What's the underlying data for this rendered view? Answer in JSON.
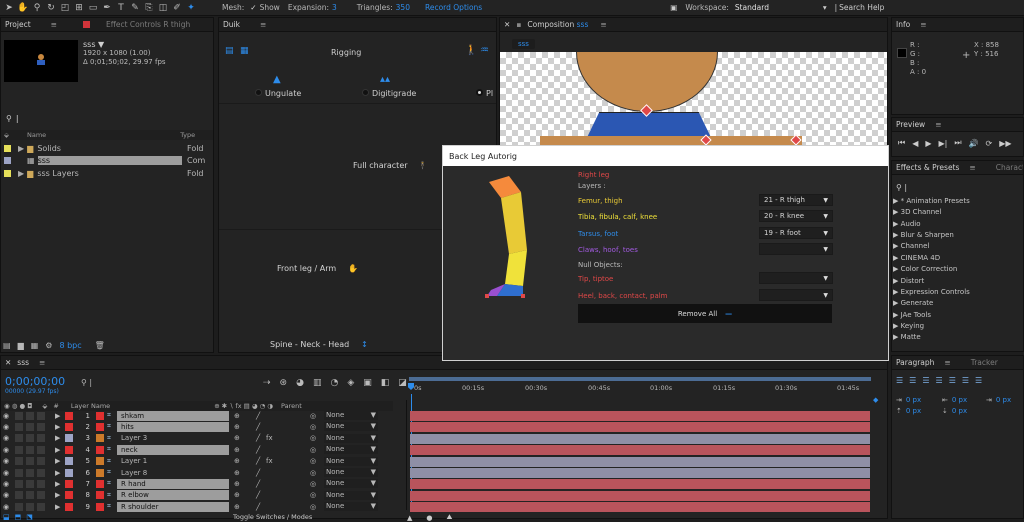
{
  "top": {
    "mesh_label": "Mesh:",
    "show_label": "Show",
    "expansion_label": "Expansion:",
    "expansion_value": "3",
    "triangles_label": "Triangles:",
    "triangles_value": "350",
    "record_options": "Record Options",
    "workspace_label": "Workspace:",
    "workspace_value": "Standard",
    "search_help": "Search Help"
  },
  "project": {
    "tab": "Project",
    "effect_controls_tab": "Effect Controls R thigh",
    "comp_name": "sss ▼",
    "comp_res": "1920 x 1080 (1.00)",
    "comp_dur": "Δ 0;01;50;02, 29.97 fps",
    "col_name": "Name",
    "col_type": "Type",
    "items": [
      {
        "name": "Solids",
        "type": "Fold"
      },
      {
        "name": "sss",
        "type": "Com"
      },
      {
        "name": "sss Layers",
        "type": "Fold"
      }
    ],
    "bpc": "8 bpc"
  },
  "duik": {
    "tab": "Duik",
    "title": "Rigging",
    "ungulate": "Ungulate",
    "digitigrade": "Digitigrade",
    "pl": "Pl",
    "full_character": "Full character",
    "front_leg": "Front leg / Arm",
    "spine": "Spine - Neck - Head"
  },
  "composition": {
    "tab": "Composition",
    "tab_name": "sss",
    "chip": "sss"
  },
  "info": {
    "tab": "Info",
    "r": "R :",
    "g": "G :",
    "b": "B :",
    "a": "A :  0",
    "x": "X : 858",
    "y": "Y : 516"
  },
  "preview": {
    "tab": "Preview"
  },
  "effects": {
    "tab": "Effects & Presets",
    "character_tab": "Character",
    "items": [
      "* Animation Presets",
      "3D Channel",
      "Audio",
      "Blur & Sharpen",
      "Channel",
      "CINEMA 4D",
      "Color Correction",
      "Distort",
      "Expression Controls",
      "Generate",
      "JAe Tools",
      "Keying",
      "Matte"
    ]
  },
  "paragraph": {
    "tab": "Paragraph",
    "tracker_tab": "Tracker",
    "v1": "0 px",
    "v2": "0 px",
    "v3": "0 px",
    "v4": "0 px",
    "v5": "0 px"
  },
  "dialog": {
    "title": "Back Leg Autorig",
    "right_leg": "Right leg",
    "layers": "Layers :",
    "femur": "Femur, thigh",
    "tibia": "Tibia, fibula, calf, knee",
    "tarsus": "Tarsus, foot",
    "claws": "Claws, hoof, toes",
    "null_objects": "Null Objects:",
    "tip": "Tip, tiptoe",
    "heel": "Heel, back, contact, palm",
    "sel1": "21 - R thigh",
    "sel2": "20 - R knee",
    "sel3": "19 - R foot",
    "remove_all": "Remove All"
  },
  "timeline": {
    "tab": "sss",
    "timecode": "0;00;00;00",
    "frames": "00000 (29.97 fps)",
    "col_layer": "Layer Name",
    "col_parent": "Parent",
    "ruler": [
      "0s",
      "00:15s",
      "00:30s",
      "00:45s",
      "01:00s",
      "01:15s",
      "01:30s",
      "01:45s"
    ],
    "toggle": "Toggle Switches / Modes",
    "layers": [
      {
        "num": "1",
        "name": "shkam",
        "color": "#e03030",
        "hl": true,
        "bar": "#b9545c"
      },
      {
        "num": "2",
        "name": "hits",
        "color": "#e03030",
        "hl": true,
        "bar": "#b9545c"
      },
      {
        "num": "3",
        "name": "Layer 3",
        "color": "#9da4c6",
        "hl": false,
        "bar": "#8f8fa6"
      },
      {
        "num": "4",
        "name": "neck",
        "color": "#e03030",
        "hl": true,
        "bar": "#b9545c"
      },
      {
        "num": "5",
        "name": "Layer 1",
        "color": "#9da4c6",
        "hl": false,
        "bar": "#8f8fa6"
      },
      {
        "num": "6",
        "name": "Layer 8",
        "color": "#9da4c6",
        "hl": false,
        "bar": "#8f8fa6"
      },
      {
        "num": "7",
        "name": "R hand",
        "color": "#e03030",
        "hl": true,
        "bar": "#b9545c"
      },
      {
        "num": "8",
        "name": "R elbow",
        "color": "#e03030",
        "hl": true,
        "bar": "#b9545c"
      },
      {
        "num": "9",
        "name": "R shoulder",
        "color": "#e03030",
        "hl": true,
        "bar": "#b9545c"
      }
    ],
    "parent_value": "None"
  }
}
